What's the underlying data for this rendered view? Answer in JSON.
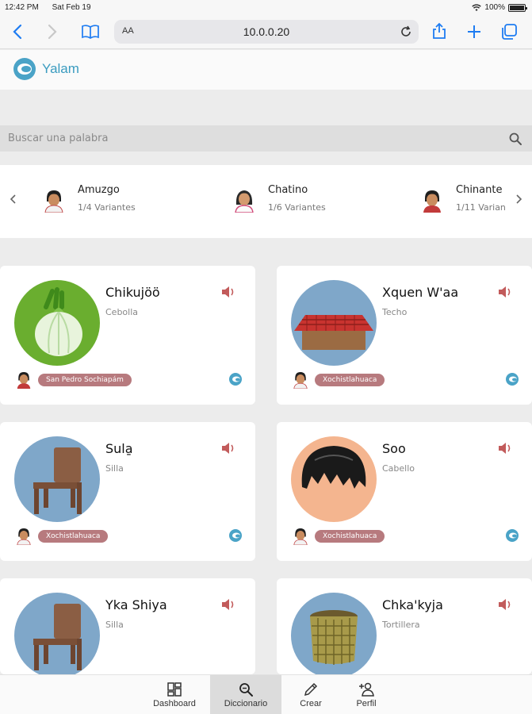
{
  "status_bar": {
    "time": "12:42 PM",
    "date": "Sat Feb 19",
    "battery": "100%",
    "battery_level": 1.0
  },
  "browser": {
    "text_size_label": "AA",
    "url": "10.0.0.20"
  },
  "app": {
    "name": "Yalam"
  },
  "search": {
    "placeholder": "Buscar una palabra"
  },
  "languages": [
    {
      "name": "Amuzgo",
      "variants": "1/4 Variantes"
    },
    {
      "name": "Chatino",
      "variants": "1/6 Variantes"
    },
    {
      "name": "Chinante",
      "variants": "1/11 Varian"
    }
  ],
  "words": [
    {
      "word": "Chikujöö",
      "translation": "Cebolla",
      "variant": "San Pedro Sochiapám",
      "image": "onion"
    },
    {
      "word": "Xquen W'aa",
      "translation": "Techo",
      "variant": "Xochistlahuaca",
      "image": "roof"
    },
    {
      "word": "Sula̱",
      "translation": "Silla",
      "variant": "Xochistlahuaca",
      "image": "chair"
    },
    {
      "word": "Soo",
      "translation": "Cabello",
      "variant": "Xochistlahuaca",
      "image": "hair"
    },
    {
      "word": "Yka Shiya",
      "translation": "Silla",
      "variant": "",
      "image": "chair"
    },
    {
      "word": "Chka'kyja",
      "translation": "Tortillera",
      "variant": "",
      "image": "basket"
    }
  ],
  "bottom_nav": [
    {
      "label": "Dashboard",
      "icon": "dashboard-icon"
    },
    {
      "label": "Diccionario",
      "icon": "dictionary-search-icon",
      "active": true
    },
    {
      "label": "Crear",
      "icon": "pencil-icon"
    },
    {
      "label": "Perfil",
      "icon": "add-user-icon"
    }
  ],
  "colors": {
    "brand": "#3b9cc0",
    "accent_ios": "#1e7cf2",
    "badge": "#b77a7e",
    "speaker": "#c25b5b"
  }
}
